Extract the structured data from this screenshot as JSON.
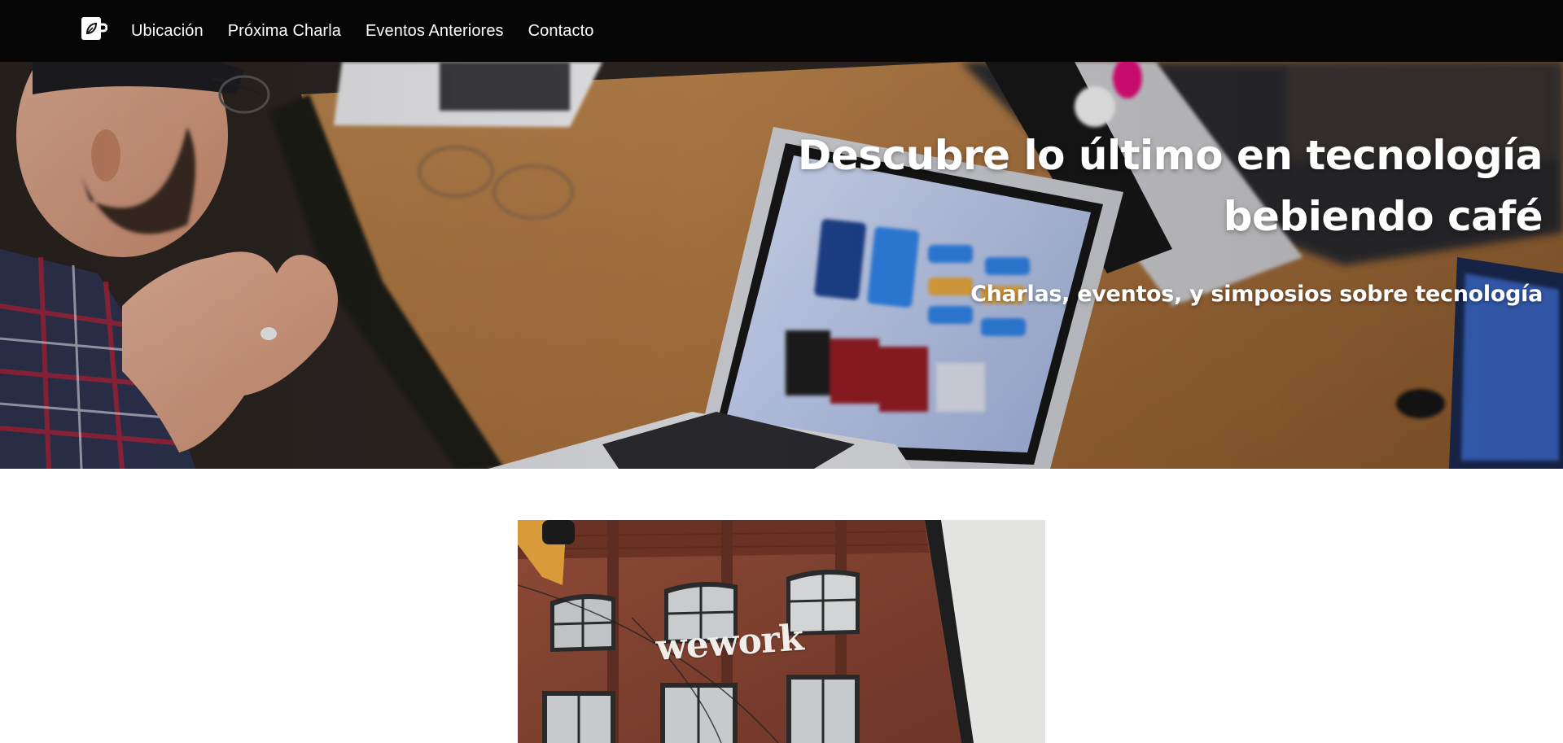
{
  "nav": {
    "logo_icon": "coffee-cup-leaf-icon",
    "links": [
      "Ubicación",
      "Próxima Charla",
      "Eventos Anteriores",
      "Contacto"
    ]
  },
  "hero": {
    "title_line1": "Descubre lo último en tecnología",
    "title_line2": "bebiendo café",
    "subtitle": "Charlas, eventos, y simposios sobre tecnología"
  },
  "location": {
    "sign_text": "wework"
  },
  "colors": {
    "nav_bg": "#060606",
    "nav_text": "#ffffff",
    "page_bg": "#ffffff"
  }
}
